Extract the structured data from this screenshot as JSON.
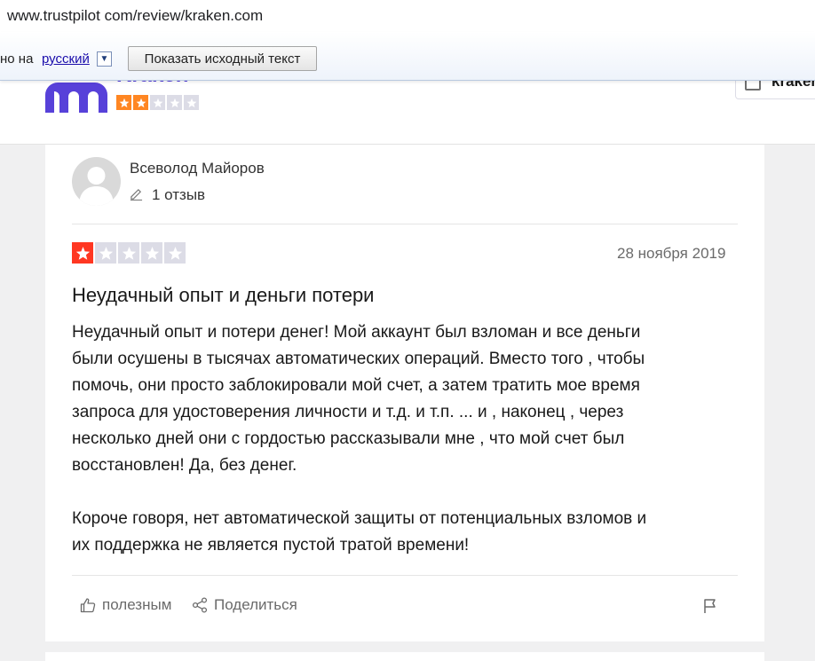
{
  "browser": {
    "url": "www.trustpilot com/review/kraken.com"
  },
  "translate_bar": {
    "prefix_text": "но на",
    "language": "русский",
    "dropdown_glyph": "▼",
    "show_original_button": "Показать исходный текст"
  },
  "header": {
    "brand_name": "Kraken",
    "brand_color": "#5741d9",
    "trust_score_stars": 2,
    "max_stars": 5,
    "right_button_text": "kraken"
  },
  "review": {
    "author": "Всеволод Майоров",
    "reviews_count": "1 отзыв",
    "stars": 1,
    "max_stars": 5,
    "date": "28 ноября 2019",
    "title": "Неудачный опыт и деньги потери",
    "body_lines_p1": [
      "Неудачный опыт и потери денег! Мой аккаунт был взломан и все деньги",
      "были осушены в тысячах автоматических операций. Вместо того , чтобы",
      "помочь, они просто заблокировали мой счет, а затем тратить мое время",
      "запроса для удостоверения личности и т.д. и т.п. ... и , наконец , через",
      "несколько дней они с гордостью рассказывали мне , что мой счет был",
      "восстановлен! Да, без денег."
    ],
    "body_lines_p2": [
      "Короче говоря, нет автоматической защиты от потенциальных взломов и",
      "их поддержка не является пустой тратой времени!"
    ],
    "useful_label": "полезным",
    "share_label": "Поделиться"
  },
  "colors": {
    "star_red": "#ff3722",
    "star_orange": "#ff8622",
    "star_empty": "#dcdce6"
  },
  "icons": [
    "pencil-icon",
    "thumbs-up-icon",
    "share-icon",
    "flag-icon",
    "avatar-placeholder-icon",
    "star-icon"
  ]
}
